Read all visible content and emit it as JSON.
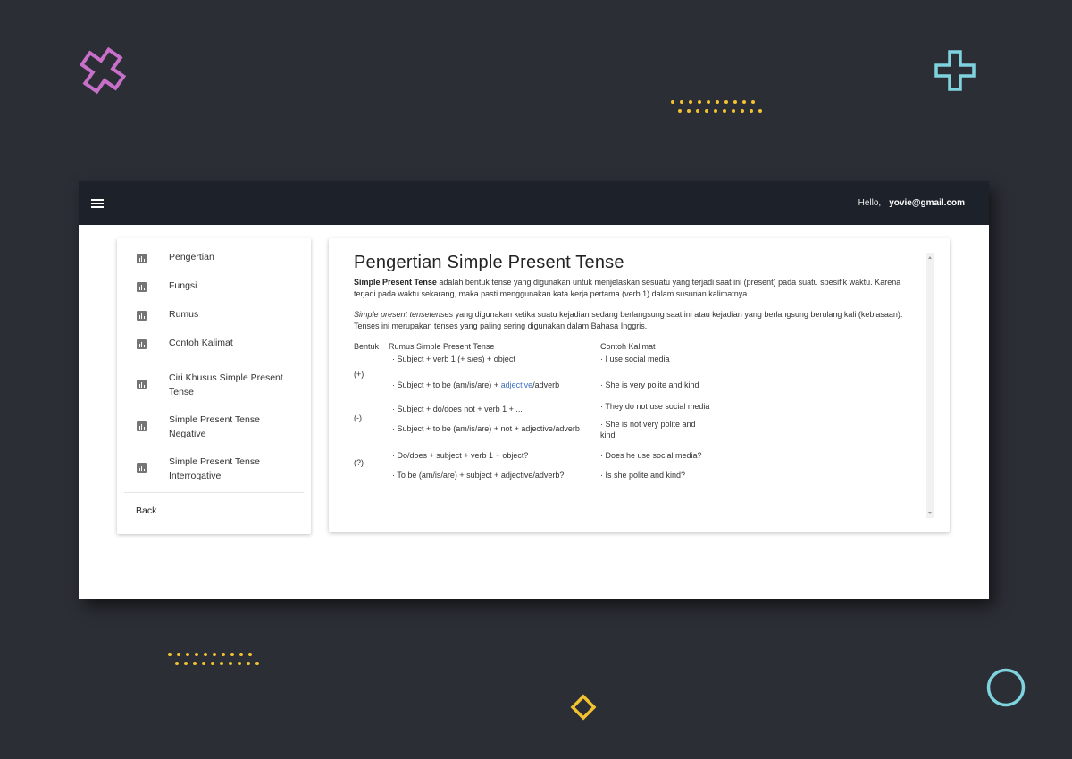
{
  "appbar": {
    "greeting": "Hello,",
    "email": "yovie@gmail.com"
  },
  "sidebar": {
    "items": [
      {
        "label": "Pengertian"
      },
      {
        "label": "Fungsi"
      },
      {
        "label": "Rumus"
      },
      {
        "label": "Contoh Kalimat"
      },
      {
        "label": "Ciri Khusus Simple Present Tense"
      },
      {
        "label": "Simple Present Tense Negative"
      },
      {
        "label": "Simple Present Tense Interrogative"
      }
    ],
    "back_label": "Back"
  },
  "content": {
    "title": "Pengertian Simple Present Tense",
    "para1_bold": "Simple Present Tense",
    "para1_rest": " adalah bentuk tense yang digunakan untuk menjelaskan sesuatu yang terjadi saat ini (present) pada suatu spesifik waktu. Karena terjadi pada waktu sekarang, maka pasti menggunakan kata kerja pertama (verb 1) dalam susunan kalimatnya.",
    "para2_italic": "Simple present tensetenses",
    "para2_rest": " yang digunakan ketika suatu kejadian sedang berlangsung saat ini atau kejadian yang berlangsung berulang kali (kebiasaan). Tenses ini merupakan tenses yang paling sering digunakan dalam Bahasa Inggris.",
    "table": {
      "headers": [
        "Bentuk",
        "Rumus Simple Present Tense",
        "Contoh Kalimat"
      ],
      "positive": {
        "form": "(+)",
        "rumus1": "· Subject + verb 1 (+ s/es) + object",
        "rumus2_pre": "· Subject + to be (am/is/are) + ",
        "rumus2_link": "adjective",
        "rumus2_post": "/adverb",
        "contoh1": "· I use social media",
        "contoh2": "· She is very polite and kind"
      },
      "negative": {
        "form": "(-)",
        "rumus1": "· Subject + do/does not + verb 1 + ...",
        "rumus2": "· Subject + to be (am/is/are) + not + adjective/adverb",
        "contoh1": "· They do not use social media",
        "contoh2": "· She is not very polite and kind"
      },
      "interrogative": {
        "form": "(?)",
        "rumus1": "· Do/does + subject + verb 1 + object?",
        "rumus2": "· To be (am/is/are) + subject + adjective/adverb?",
        "contoh1": "· Does he use social media?",
        "contoh2": "· Is she polite and kind?"
      }
    }
  },
  "colors": {
    "background": "#2b2e35",
    "appbar": "#1d212a",
    "accent_pink": "#c86fc9",
    "accent_cyan": "#7fd3df",
    "accent_yellow": "#f2c230",
    "link": "#3f6fc2"
  },
  "icons": {
    "menu": "hamburger-menu-icon",
    "nav": "bar-chart-icon"
  }
}
